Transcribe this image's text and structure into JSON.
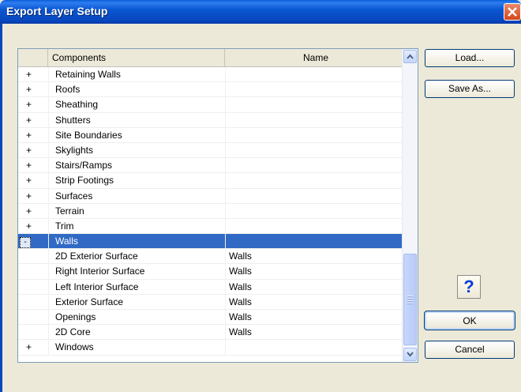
{
  "window": {
    "title": "Export Layer Setup"
  },
  "grid": {
    "columns": [
      "",
      "Components",
      "Name"
    ],
    "rows": [
      {
        "toggle": "+",
        "component": "Retaining Walls",
        "name": ""
      },
      {
        "toggle": "+",
        "component": "Roofs",
        "name": ""
      },
      {
        "toggle": "+",
        "component": "Sheathing",
        "name": ""
      },
      {
        "toggle": "+",
        "component": "Shutters",
        "name": ""
      },
      {
        "toggle": "+",
        "component": "Site Boundaries",
        "name": ""
      },
      {
        "toggle": "+",
        "component": "Skylights",
        "name": ""
      },
      {
        "toggle": "+",
        "component": "Stairs/Ramps",
        "name": ""
      },
      {
        "toggle": "+",
        "component": "Strip Footings",
        "name": ""
      },
      {
        "toggle": "+",
        "component": "Surfaces",
        "name": ""
      },
      {
        "toggle": "+",
        "component": "Terrain",
        "name": ""
      },
      {
        "toggle": "+",
        "component": "Trim",
        "name": ""
      },
      {
        "toggle": "-",
        "component": "Walls",
        "name": "",
        "selected": true
      },
      {
        "toggle": "",
        "component": "2D Exterior Surface",
        "name": "Walls"
      },
      {
        "toggle": "",
        "component": "Right Interior Surface",
        "name": "Walls"
      },
      {
        "toggle": "",
        "component": "Left Interior Surface",
        "name": "Walls"
      },
      {
        "toggle": "",
        "component": "Exterior Surface",
        "name": "Walls"
      },
      {
        "toggle": "",
        "component": "Openings",
        "name": "Walls"
      },
      {
        "toggle": "",
        "component": "2D Core",
        "name": "Walls"
      },
      {
        "toggle": "+",
        "component": "Windows",
        "name": ""
      }
    ]
  },
  "buttons": {
    "load": "Load...",
    "save_as": "Save As...",
    "help": "?",
    "ok": "OK",
    "cancel": "Cancel"
  },
  "colors": {
    "titlebar": "#0a57d2",
    "selection": "#316ac5",
    "dialog_bg": "#ece9d8"
  }
}
